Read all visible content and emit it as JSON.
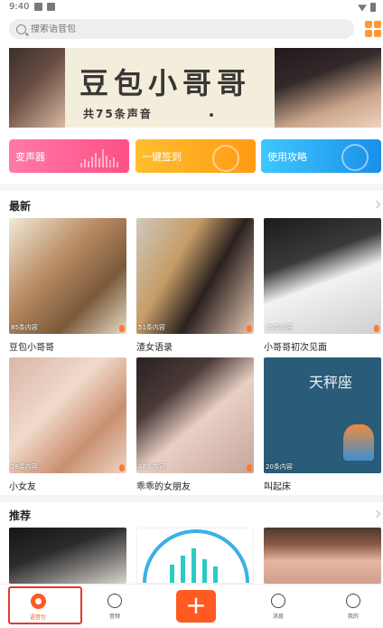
{
  "status_bar": {
    "time": "9:40"
  },
  "search": {
    "placeholder": "搜索语音包"
  },
  "banner": {
    "title": "豆包小哥哥",
    "subtitle": "共75条声音"
  },
  "quick_actions": [
    {
      "label": "变声器",
      "color": "#ff5a8e"
    },
    {
      "label": "一键签到",
      "color": "#ffa81e"
    },
    {
      "label": "使用攻略",
      "color": "#27a7f2"
    }
  ],
  "latest": {
    "title": "最新",
    "items": [
      {
        "count": "85条内容",
        "title": "豆包小哥哥"
      },
      {
        "count": "51条内容",
        "title": "渣女语录"
      },
      {
        "count": "35条内容",
        "title": "小哥哥初次见面"
      },
      {
        "count": "28条内容",
        "title": "小女友"
      },
      {
        "count": "48条内容",
        "title": "乖乖的女朋友"
      },
      {
        "count": "20条内容",
        "title": "叫起床"
      }
    ]
  },
  "recommended": {
    "title": "推荐"
  },
  "thumb_texts": {
    "libra": "天秤座"
  },
  "bottom_nav": {
    "items": [
      {
        "label": "语音包",
        "icon": "voice-pack-icon",
        "active": true
      },
      {
        "label": "音频",
        "icon": "audio-icon"
      },
      {
        "label": "+",
        "icon": "add-icon"
      },
      {
        "label": "消息",
        "icon": "message-icon"
      },
      {
        "label": "我的",
        "icon": "profile-icon"
      }
    ]
  },
  "colors": {
    "accent": "#ff5a22",
    "highlight": "#e23b2e"
  }
}
